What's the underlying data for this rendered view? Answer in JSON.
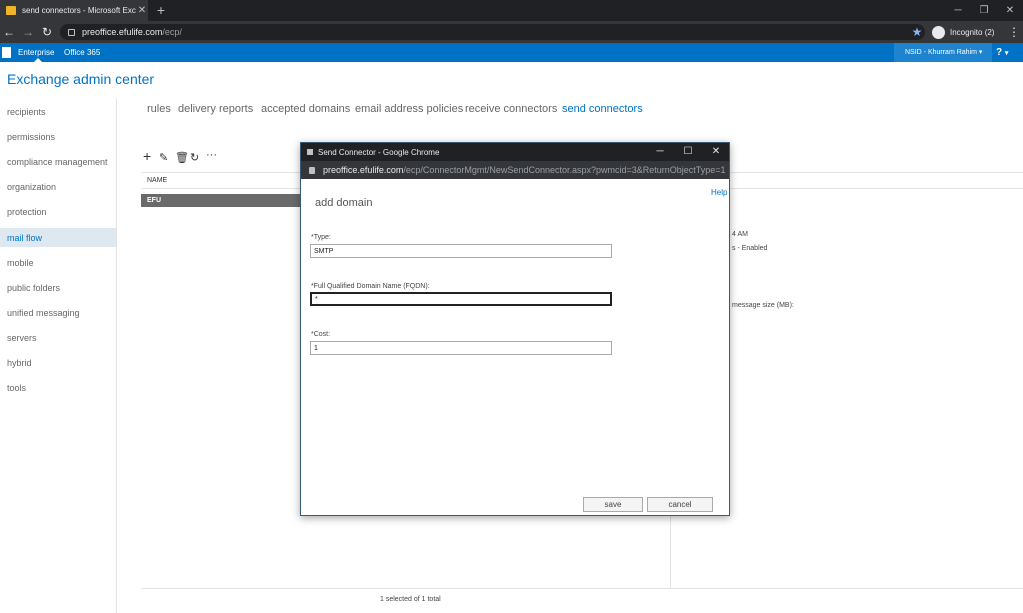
{
  "browser": {
    "tab_title": "send connectors - Microsoft Exch",
    "url_host": "preoffice.efulife.com",
    "url_path": "/ecp/",
    "incognito_label": "Incognito (2)"
  },
  "o365": {
    "tabs": [
      "Enterprise",
      "Office 365"
    ],
    "user": "NSID - Khurram Rahim",
    "help": "?"
  },
  "eac": {
    "title": "Exchange admin center",
    "nav": [
      "recipients",
      "permissions",
      "compliance management",
      "organization",
      "protection",
      "mail flow",
      "mobile",
      "public folders",
      "unified messaging",
      "servers",
      "hybrid",
      "tools"
    ],
    "selected_nav": "mail flow",
    "subtabs": [
      "rules",
      "delivery reports",
      "accepted domains",
      "email address policies",
      "receive connectors",
      "send connectors"
    ],
    "active_subtab": "send connectors",
    "list_header": "NAME",
    "rows": [
      "EFU"
    ],
    "detail_frag_1": "4 AM",
    "detail_frag_2": "s - Enabled",
    "detail_frag_3": "message size (MB):",
    "status": "1 selected of 1 total"
  },
  "popup": {
    "title": "Send Connector - Google Chrome",
    "url_host": "preoffice.efulife.com",
    "url_path": "/ecp/ConnectorMgmt/NewSendConnector.aspx?pwmcid=3&ReturnObjectType=1",
    "help": "Help",
    "heading": "add domain",
    "fields": {
      "type_label": "*Type:",
      "type_value": "SMTP",
      "fqdn_label": "*Full Qualified Domain Name (FQDN):",
      "fqdn_value": "*",
      "cost_label": "*Cost:",
      "cost_value": "1"
    },
    "save": "save",
    "cancel": "cancel"
  }
}
